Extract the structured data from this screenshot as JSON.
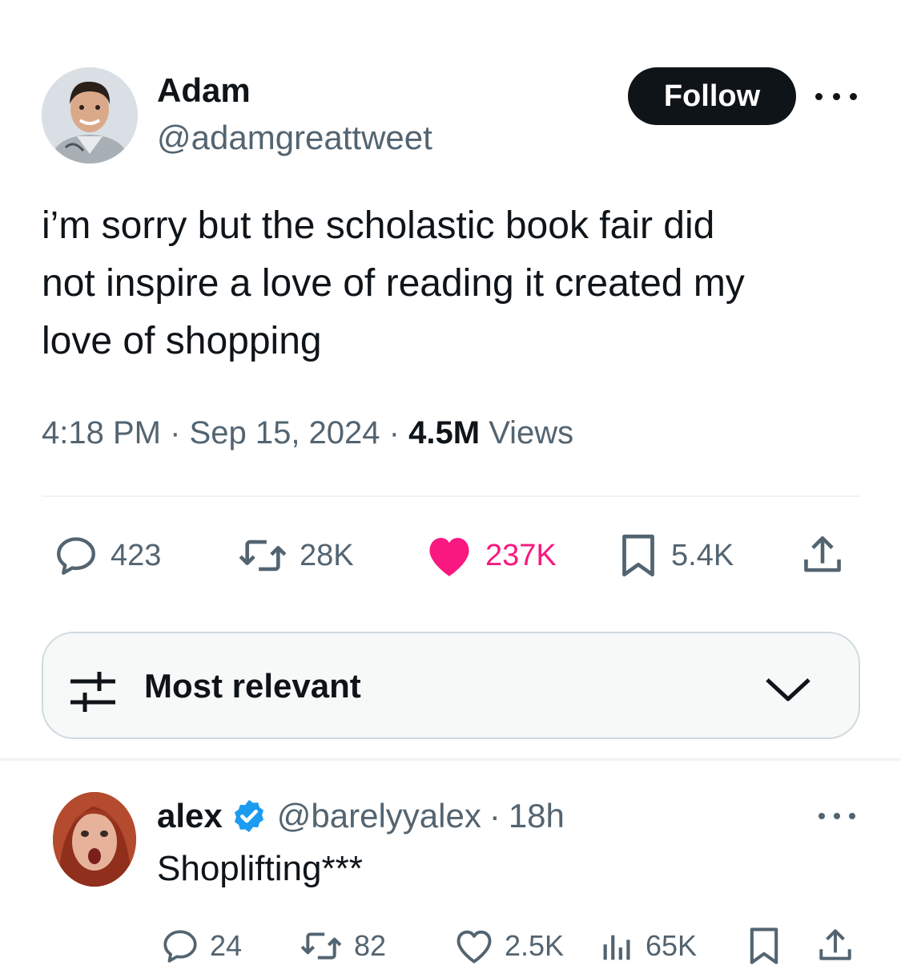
{
  "tweet": {
    "author": {
      "display_name": "Adam",
      "handle": "@adamgreattweet"
    },
    "follow_label": "Follow",
    "text": "i’m sorry but the scholastic book fair did\nnot inspire a love of reading it created my\nlove of shopping",
    "time": "4:18 PM",
    "separator": "·",
    "date": "Sep 15, 2024",
    "views_count": "4.5M",
    "views_label": "Views",
    "stats": {
      "replies": "423",
      "reposts": "28K",
      "likes": "237K",
      "bookmarks": "5.4K"
    }
  },
  "sort": {
    "label": "Most relevant"
  },
  "reply": {
    "display_name": "alex",
    "handle": "@barelyyalex",
    "time": "18h",
    "text": "Shoplifting***",
    "stats": {
      "replies": "24",
      "reposts": "82",
      "likes": "2.5K",
      "views": "65K"
    }
  },
  "colors": {
    "text": "#0f1419",
    "secondary": "#536471",
    "like": "#f91880",
    "verified": "#1d9bf0",
    "divider": "#eff3f4"
  },
  "icons": [
    "more-icon",
    "reply-icon",
    "repost-icon",
    "heart-filled-icon",
    "bookmark-icon",
    "share-icon",
    "filter-icon",
    "chevron-down-icon",
    "verified-badge-icon",
    "heart-icon",
    "views-icon"
  ]
}
